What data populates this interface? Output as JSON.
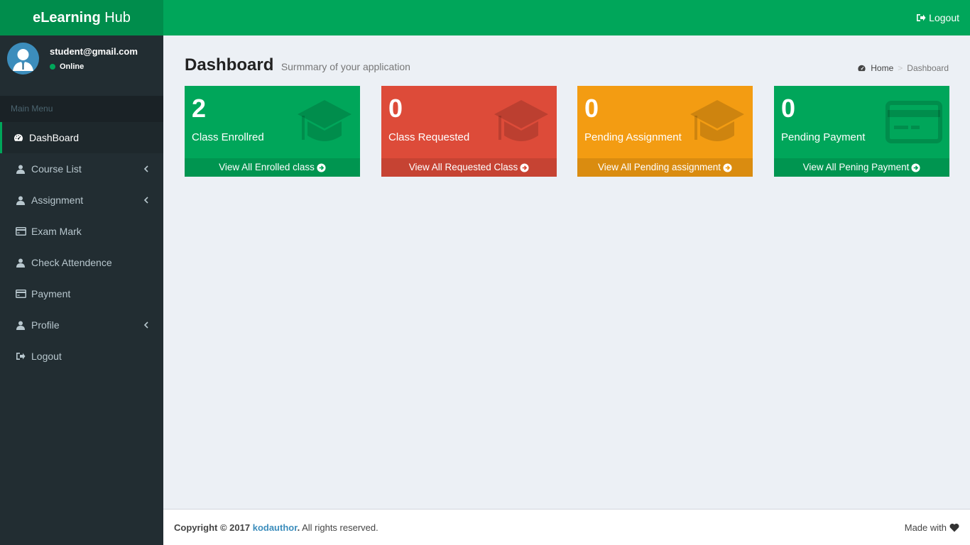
{
  "header": {
    "logo_bold": "eLearning",
    "logo_rest": " Hub",
    "logout_label": "Logout"
  },
  "user": {
    "email": "student@gmail.com",
    "status": "Online"
  },
  "sidebar": {
    "section_label": "Main Menu",
    "items": [
      {
        "label": "DashBoard",
        "icon": "dashboard-icon"
      },
      {
        "label": "Course List",
        "icon": "user-icon"
      },
      {
        "label": "Assignment",
        "icon": "user-icon"
      },
      {
        "label": "Exam Mark",
        "icon": "credit-card-icon"
      },
      {
        "label": "Check Attendence",
        "icon": "user-icon"
      },
      {
        "label": "Payment",
        "icon": "credit-card-icon"
      },
      {
        "label": "Profile",
        "icon": "user-icon"
      },
      {
        "label": "Logout",
        "icon": "sign-out-icon"
      }
    ]
  },
  "content": {
    "title": "Dashboard",
    "subtitle": "Surmmary of your application",
    "breadcrumb": {
      "home": "Home",
      "current": "Dashboard"
    }
  },
  "stats": [
    {
      "value": "2",
      "label": "Class Enrollred",
      "link": "View All Enrolled class",
      "color": "#00a65a",
      "icon": "graduation-cap-icon"
    },
    {
      "value": "0",
      "label": "Class Requested",
      "link": "View All Requested Class",
      "color": "#dd4b39",
      "icon": "graduation-cap-icon"
    },
    {
      "value": "0",
      "label": "Pending Assignment",
      "link": "View All Pending assignment",
      "color": "#f39c12",
      "icon": "graduation-cap-icon"
    },
    {
      "value": "0",
      "label": "Pending Payment",
      "link": "View All Pening Payment",
      "color": "#00a65a",
      "icon": "credit-card-icon"
    }
  ],
  "footer": {
    "copyright_prefix": "Copyright © 2017 ",
    "brand": "kodauthor",
    "dot": ".",
    "rights": " All rights reserved.",
    "made_with": "Made with"
  }
}
